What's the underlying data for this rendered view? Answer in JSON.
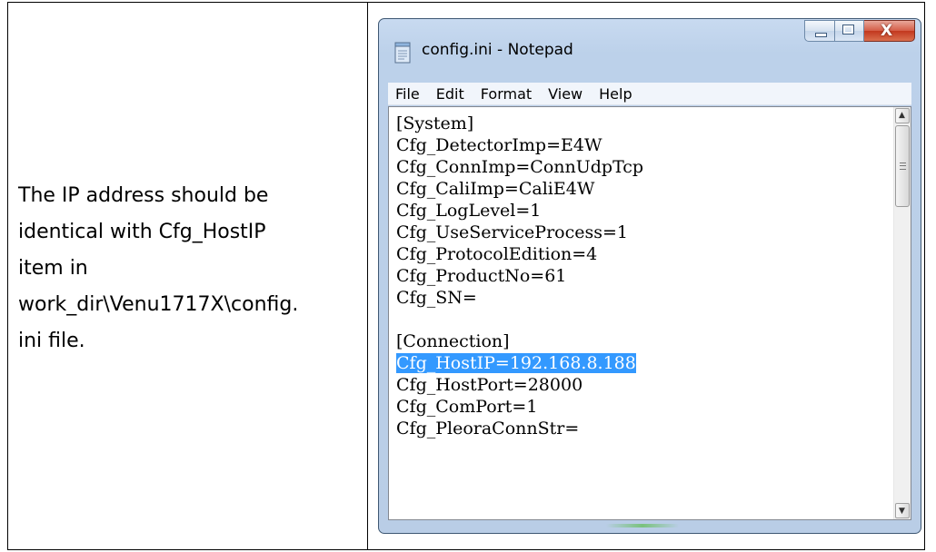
{
  "description_cell": {
    "lines": [
      "The IP address should be",
      "identical with Cfg_HostIP",
      "item in",
      "work_dir\\Venu1717X\\config.",
      "ini file."
    ]
  },
  "notepad": {
    "title": "config.ini - Notepad",
    "icons": {
      "app": "notepad-icon",
      "minimize": "minimize-icon",
      "maximize": "maximize-icon",
      "close": "close-icon",
      "scroll_up": "arrow-up-icon",
      "scroll_down": "arrow-down-icon"
    },
    "close_glyph": "X",
    "menu": [
      "File",
      "Edit",
      "Format",
      "View",
      "Help"
    ],
    "lines": [
      "[System]",
      "Cfg_DetectorImp=E4W",
      "Cfg_ConnImp=ConnUdpTcp",
      "Cfg_CaliImp=CaliE4W",
      "Cfg_LogLevel=1",
      "Cfg_UseServiceProcess=1",
      "Cfg_ProtocolEdition=4",
      "Cfg_ProductNo=61",
      "Cfg_SN=",
      "",
      "[Connection]",
      "Cfg_HostIP=192.168.8.188",
      "Cfg_HostPort=28000",
      "Cfg_ComPort=1",
      "Cfg_PleoraConnStr="
    ],
    "selected_line": "Cfg_HostIP=192.168.8.188",
    "colors": {
      "selection": "#3399ff",
      "frame": "#bcd1ea",
      "close_button": "#c2381f"
    }
  }
}
